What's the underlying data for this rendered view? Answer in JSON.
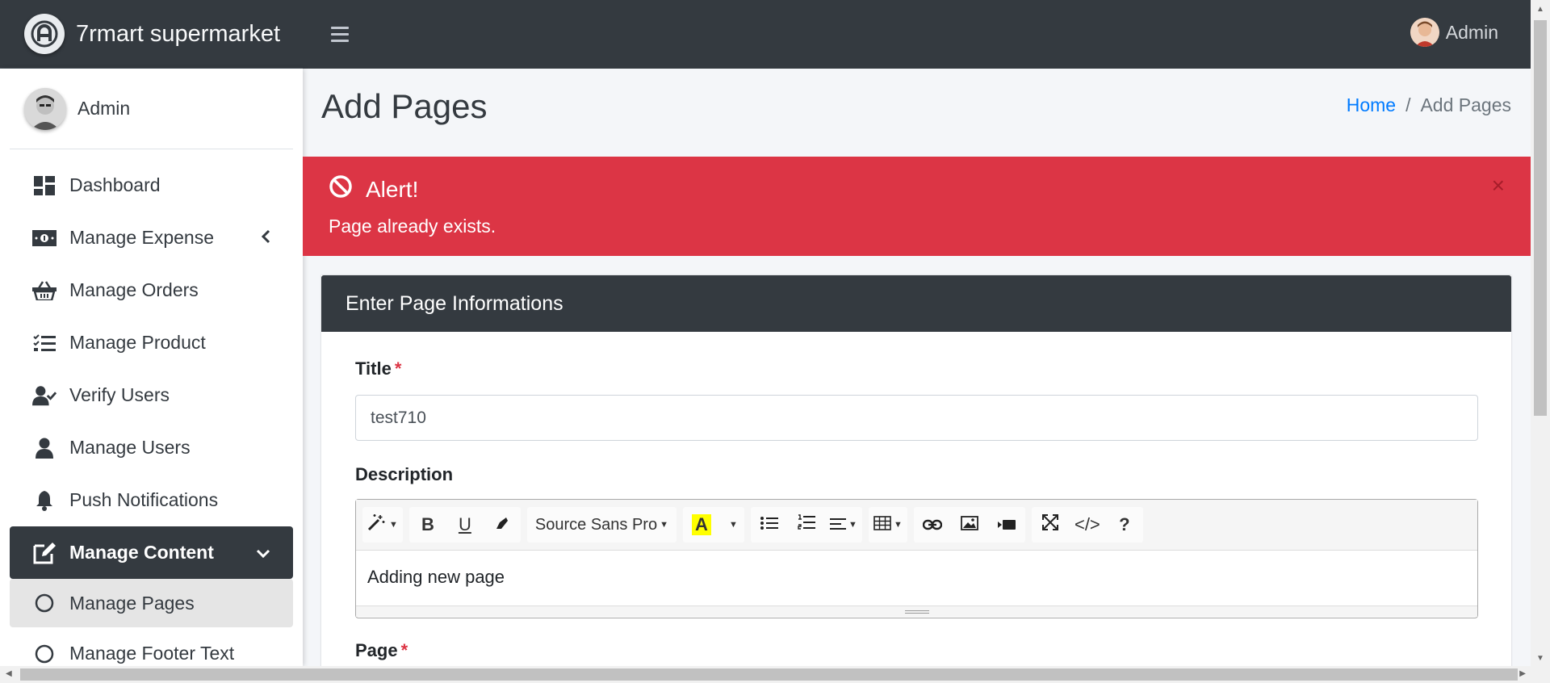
{
  "brand": {
    "name": "7rmart supermarket"
  },
  "topbar": {
    "user": "Admin"
  },
  "sidebar": {
    "user": "Admin",
    "items": [
      {
        "label": "Dashboard",
        "icon": "dashboard-icon"
      },
      {
        "label": "Manage Expense",
        "icon": "money-icon"
      },
      {
        "label": "Manage Orders",
        "icon": "basket-icon"
      },
      {
        "label": "Manage Product",
        "icon": "list-check-icon"
      },
      {
        "label": "Verify Users",
        "icon": "user-check-icon"
      },
      {
        "label": "Manage Users",
        "icon": "user-icon"
      },
      {
        "label": "Push Notifications",
        "icon": "bell-icon"
      },
      {
        "label": "Manage Content",
        "icon": "edit-icon"
      },
      {
        "label": "Manage Pages",
        "icon": "circle-icon"
      },
      {
        "label": "Manage Footer Text",
        "icon": "circle-icon"
      }
    ]
  },
  "header": {
    "title": "Add Pages"
  },
  "breadcrumb": {
    "home": "Home",
    "separator": "/",
    "current": "Add Pages"
  },
  "alert": {
    "title": "Alert!",
    "message": "Page already exists.",
    "close": "×",
    "color": "#dc3545"
  },
  "form": {
    "card_title": "Enter Page Informations",
    "title_label": "Title",
    "title_value": "test710",
    "required_mark": "*",
    "description_label": "Description",
    "font_name": "Source Sans Pro",
    "description_value": "Adding new page",
    "page_label": "Page"
  },
  "toolbar": {
    "bold": "B",
    "underline": "U",
    "highlight": "A",
    "code": "</>",
    "help": "?"
  },
  "colors": {
    "dark": "#343a40",
    "link": "#007bff",
    "danger": "#dc3545"
  }
}
